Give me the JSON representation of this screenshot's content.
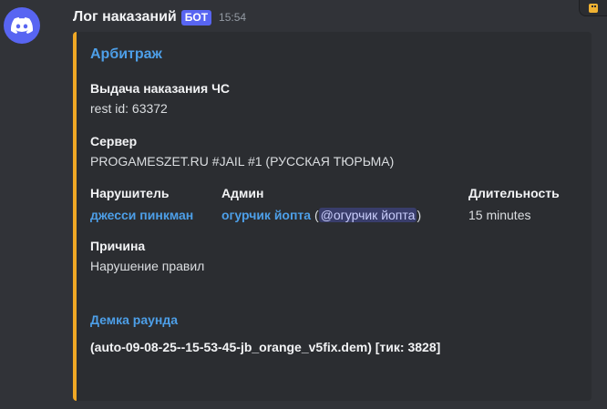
{
  "message": {
    "username": "Лог наказаний",
    "bot_tag": "БОТ",
    "timestamp": "15:54",
    "avatar_icon": "discord-logo-icon",
    "colors": {
      "embed_border": "#f0a825",
      "link": "#4d9fe8",
      "bot_tag": "#5865f2"
    }
  },
  "embed": {
    "title": "Арбитраж",
    "punishment": {
      "name": "Выдача наказания ЧС",
      "value": "rest id: 63372"
    },
    "server": {
      "name": "Сервер",
      "value": "PROGAMESZET.RU #JAIL #1 (РУССКАЯ ТЮРЬМА)"
    },
    "offender": {
      "name": "Нарушитель",
      "value": "джесси пинкман"
    },
    "admin": {
      "name": "Админ",
      "value": "огурчик йопта",
      "paren_open": "(",
      "mention": "@огурчик йопта",
      "paren_close": ")"
    },
    "duration": {
      "name": "Длительность",
      "value": "15 minutes"
    },
    "reason": {
      "name": "Причина",
      "value": "Нарушение правил"
    },
    "demo": {
      "name": "Демка раунда",
      "value": "(auto-09-08-25--15-53-45-jb_orange_v5fix.dem) [тик: 3828]"
    }
  }
}
